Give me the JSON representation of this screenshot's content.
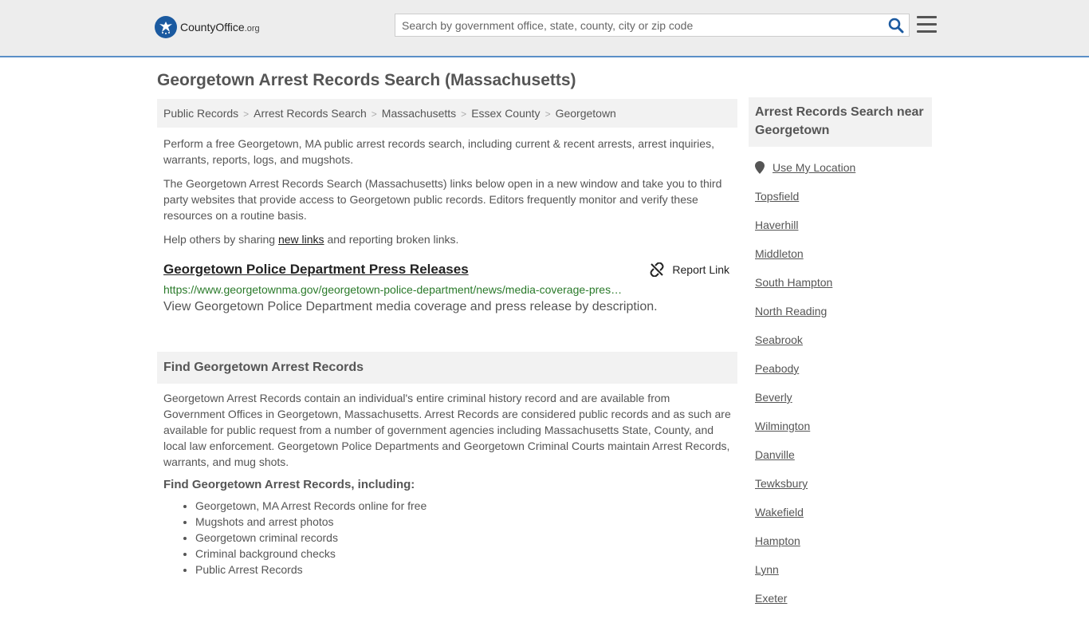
{
  "header": {
    "logo_main": "CountyOffice",
    "logo_suffix": ".org",
    "search_placeholder": "Search by government office, state, county, city or zip code"
  },
  "page_title": "Georgetown Arrest Records Search (Massachusetts)",
  "breadcrumb": [
    "Public Records",
    "Arrest Records Search",
    "Massachusetts",
    "Essex County",
    "Georgetown"
  ],
  "intro": {
    "p1": "Perform a free Georgetown, MA public arrest records search, including current & recent arrests, arrest inquiries, warrants, reports, logs, and mugshots.",
    "p2": "The Georgetown Arrest Records Search (Massachusetts) links below open in a new window and take you to third party websites that provide access to Georgetown public records. Editors frequently monitor and verify these resources on a routine basis.",
    "p3_before": "Help others by sharing ",
    "p3_link": "new links",
    "p3_after": " and reporting broken links."
  },
  "record": {
    "title": "Georgetown Police Department Press Releases",
    "report_label": "Report Link",
    "url": "https://www.georgetownma.gov/georgetown-police-department/news/media-coverage-pres…",
    "description": "View Georgetown Police Department media coverage and press release by description."
  },
  "section": {
    "heading": "Find Georgetown Arrest Records",
    "body": "Georgetown Arrest Records contain an individual's entire criminal history record and are available from Government Offices in Georgetown, Massachusetts. Arrest Records are considered public records and as such are available for public request from a number of government agencies including Massachusetts State, County, and local law enforcement. Georgetown Police Departments and Georgetown Criminal Courts maintain Arrest Records, warrants, and mug shots.",
    "subheading": "Find Georgetown Arrest Records, including:",
    "items": [
      "Georgetown, MA Arrest Records online for free",
      "Mugshots and arrest photos",
      "Georgetown criminal records",
      "Criminal background checks",
      "Public Arrest Records"
    ]
  },
  "sidebar": {
    "heading": "Arrest Records Search near Georgetown",
    "use_location": "Use My Location",
    "nearby": [
      "Topsfield",
      "Haverhill",
      "Middleton",
      "South Hampton",
      "North Reading",
      "Seabrook",
      "Peabody",
      "Beverly",
      "Wilmington",
      "Danville",
      "Tewksbury",
      "Wakefield",
      "Hampton",
      "Lynn",
      "Exeter"
    ]
  },
  "colors": {
    "brand_blue": "#1b5aa0",
    "url_green": "#2a7a2a",
    "header_bg": "#ededed"
  }
}
